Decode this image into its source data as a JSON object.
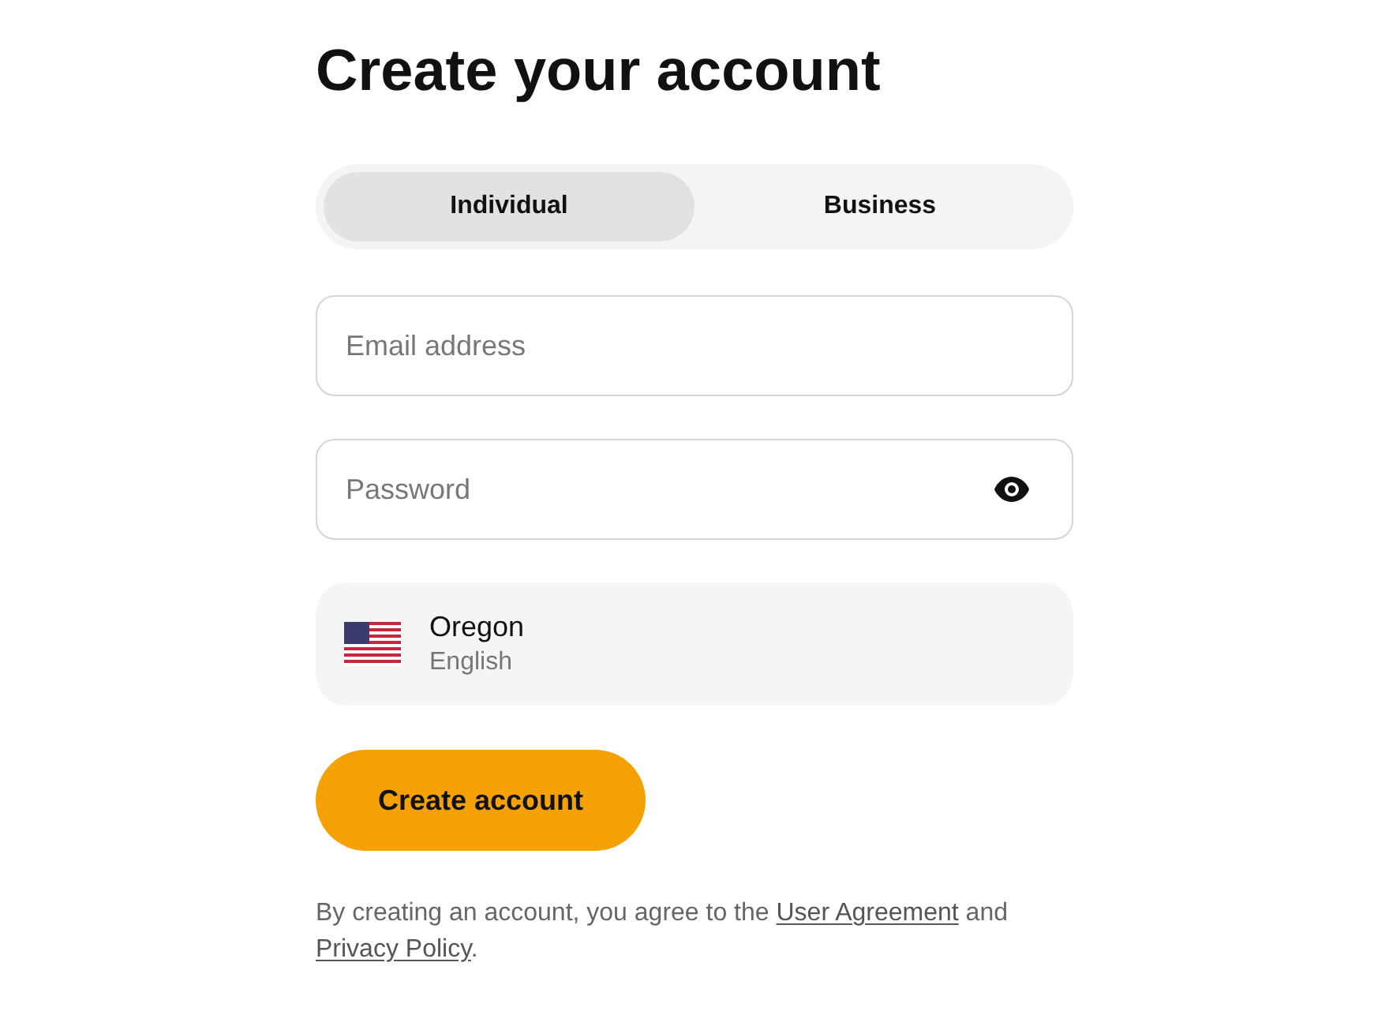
{
  "title": "Create your account",
  "tabs": [
    {
      "label": "Individual",
      "selected": true
    },
    {
      "label": "Business",
      "selected": false
    }
  ],
  "email_field": {
    "placeholder": "Email address"
  },
  "password_field": {
    "placeholder": "Password"
  },
  "region": {
    "name": "Oregon",
    "language": "English"
  },
  "submit_button": "Create account",
  "terms": [
    {
      "kind": "text",
      "text": "By creating an account, you agree to the "
    },
    {
      "kind": "link",
      "text": "User Agreement"
    },
    {
      "kind": "text",
      "text": " and "
    },
    {
      "kind": "link",
      "text": "Privacy Policy"
    },
    {
      "kind": "text",
      "text": "."
    }
  ]
}
